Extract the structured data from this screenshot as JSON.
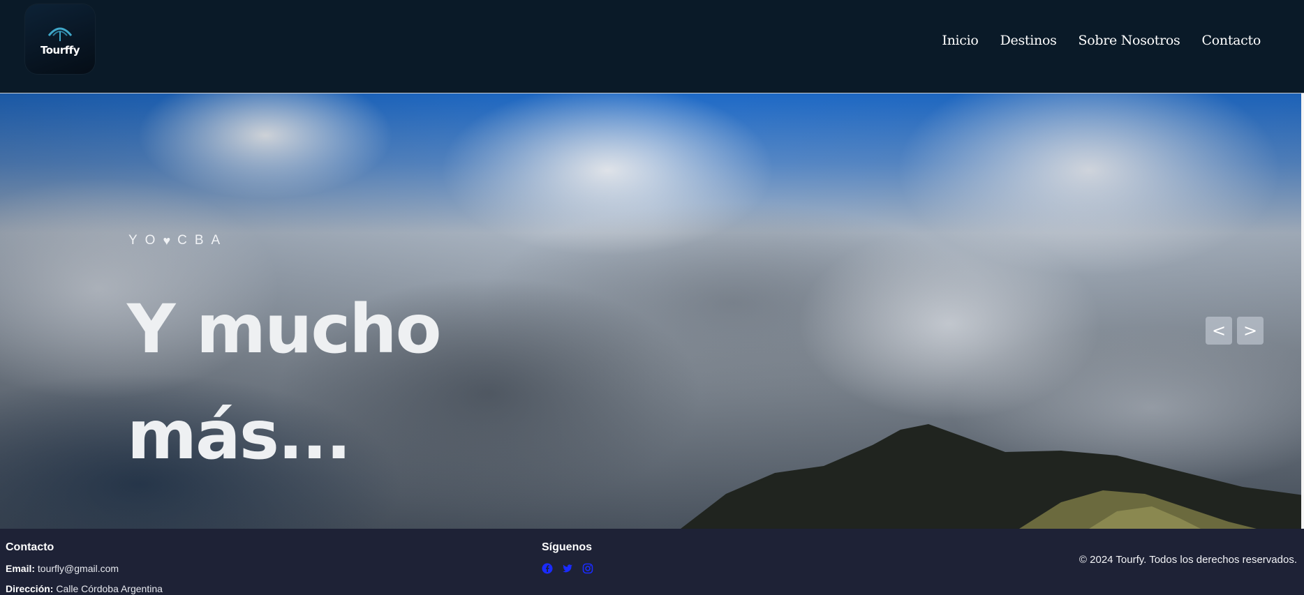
{
  "header": {
    "logo_text": "Tourffy",
    "nav": [
      {
        "label": "Inicio"
      },
      {
        "label": "Destinos"
      },
      {
        "label": "Sobre Nosotros"
      },
      {
        "label": "Contacto"
      }
    ]
  },
  "hero": {
    "eyebrow_pre": "YO",
    "eyebrow_icon": "heart-icon",
    "eyebrow_post": "CBA",
    "title": "Y mucho más...",
    "prev_label": "<",
    "next_label": ">"
  },
  "footer": {
    "contact": {
      "heading": "Contacto",
      "email_label": "Email:",
      "email_value": "tourfly@gmail.com",
      "address_label": "Dirección:",
      "address_value": "Calle Córdoba Argentina"
    },
    "social": {
      "heading": "Síguenos",
      "icons": [
        "facebook-icon",
        "twitter-icon",
        "instagram-icon"
      ]
    },
    "copyright": "© 2024 Tourfy. Todos los derechos reservados."
  },
  "colors": {
    "header_bg": "#0a1a28",
    "footer_bg": "#1e2236",
    "social_icon": "#1a2bff"
  }
}
